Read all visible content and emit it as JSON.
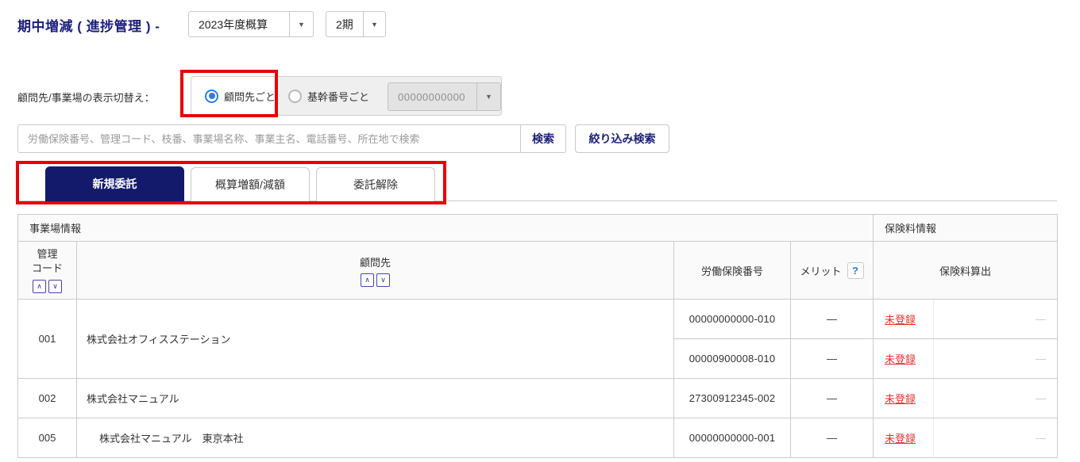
{
  "header": {
    "title": "期中増減 ( 進捗管理 ) -",
    "year_select_value": "2023年度概算",
    "term_select_value": "2期"
  },
  "icons": {
    "dropdown_arrow": "▼",
    "sort_up": "∧",
    "sort_down": "∨",
    "help": "?"
  },
  "view_switch": {
    "label": "顧問先/事業場の表示切替え：",
    "radio_client_label": "顧問先ごと",
    "radio_base_label": "基幹番号ごと",
    "base_number_value": "00000000000"
  },
  "search": {
    "placeholder": "労働保険番号、管理コード、枝番、事業場名称、事業主名、電話番号、所在地で検索",
    "search_button": "検索",
    "filter_button": "絞り込み検索"
  },
  "tabs": [
    {
      "label": "新規委託",
      "active": true
    },
    {
      "label": "概算増額/減額",
      "active": false
    },
    {
      "label": "委託解除",
      "active": false
    }
  ],
  "table": {
    "group_headers": {
      "office_info": "事業場情報",
      "insurance_info": "保険料情報"
    },
    "columns": {
      "code_line1": "管理",
      "code_line2": "コード",
      "client": "顧問先",
      "labor_insurance_no": "労働保険番号",
      "merit": "メリット",
      "premium_calc": "保険料算出"
    },
    "rows": [
      {
        "code": "001",
        "company": "株式会社オフィスステーション",
        "entries": [
          {
            "labor_no": "00000000000-010",
            "merit": "―",
            "status": "未登録",
            "dash": "—"
          },
          {
            "labor_no": "00000900008-010",
            "merit": "―",
            "status": "未登録",
            "dash": "—"
          }
        ]
      },
      {
        "code": "002",
        "company": "株式会社マニュアル",
        "entries": [
          {
            "labor_no": "27300912345-002",
            "merit": "―",
            "status": "未登録",
            "dash": "—"
          }
        ]
      },
      {
        "code": "005",
        "company": "株式会社マニュアル　東京本社",
        "entries": [
          {
            "labor_no": "00000000000-001",
            "merit": "―",
            "status": "未登録",
            "dash": "—"
          }
        ]
      }
    ]
  },
  "colors": {
    "navy": "#1c1f7b",
    "active_tab_bg": "#131a6b",
    "annotation_red": "#e60000",
    "status_red": "#e03232",
    "radio_blue": "#2e7ce0"
  }
}
